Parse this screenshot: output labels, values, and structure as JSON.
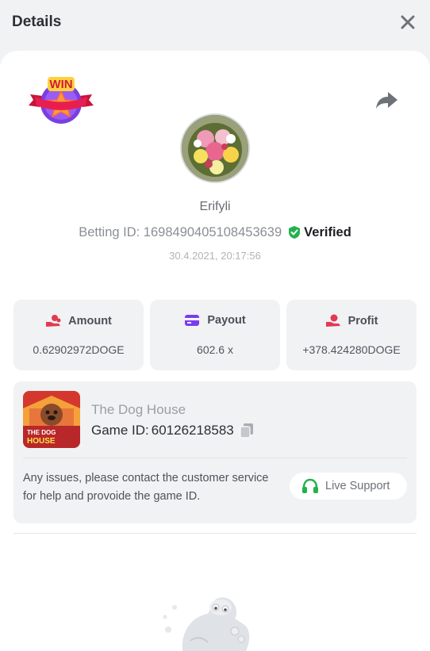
{
  "header": {
    "title": "Details",
    "close_icon": "close-icon"
  },
  "badge": {
    "text": "WIN",
    "icon": "win-star-ribbon-icon"
  },
  "share_icon": "share-icon",
  "user": {
    "name": "Erifyli",
    "avatar": "flower-bouquet-avatar"
  },
  "bet": {
    "id_text": "Betting ID: 1698490405108453639",
    "verified_label": "Verified",
    "verified_color": "#22b24c",
    "timestamp": "30.4.2021, 20:17:56"
  },
  "stats": {
    "amount": {
      "label": "Amount",
      "value": "0.62902972DOGE",
      "icon": "coins-hand-icon"
    },
    "payout": {
      "label": "Payout",
      "value": "602.6 x",
      "icon": "card-icon"
    },
    "profit": {
      "label": "Profit",
      "value": "+378.424280DOGE",
      "icon": "coin-hand-icon"
    }
  },
  "game": {
    "name": "The Dog House",
    "id_label": "Game ID:",
    "id_value": "60126218583",
    "thumb_title_line1": "THE DOG",
    "thumb_title_line2": "HOUSE",
    "issue_text": "Any issues, please contact the customer service for help and provoide the game ID.",
    "support_label": "Live Support"
  },
  "colors": {
    "accent_red": "#e23a52",
    "accent_purple": "#7a3cf0",
    "accent_green": "#22b24c"
  }
}
